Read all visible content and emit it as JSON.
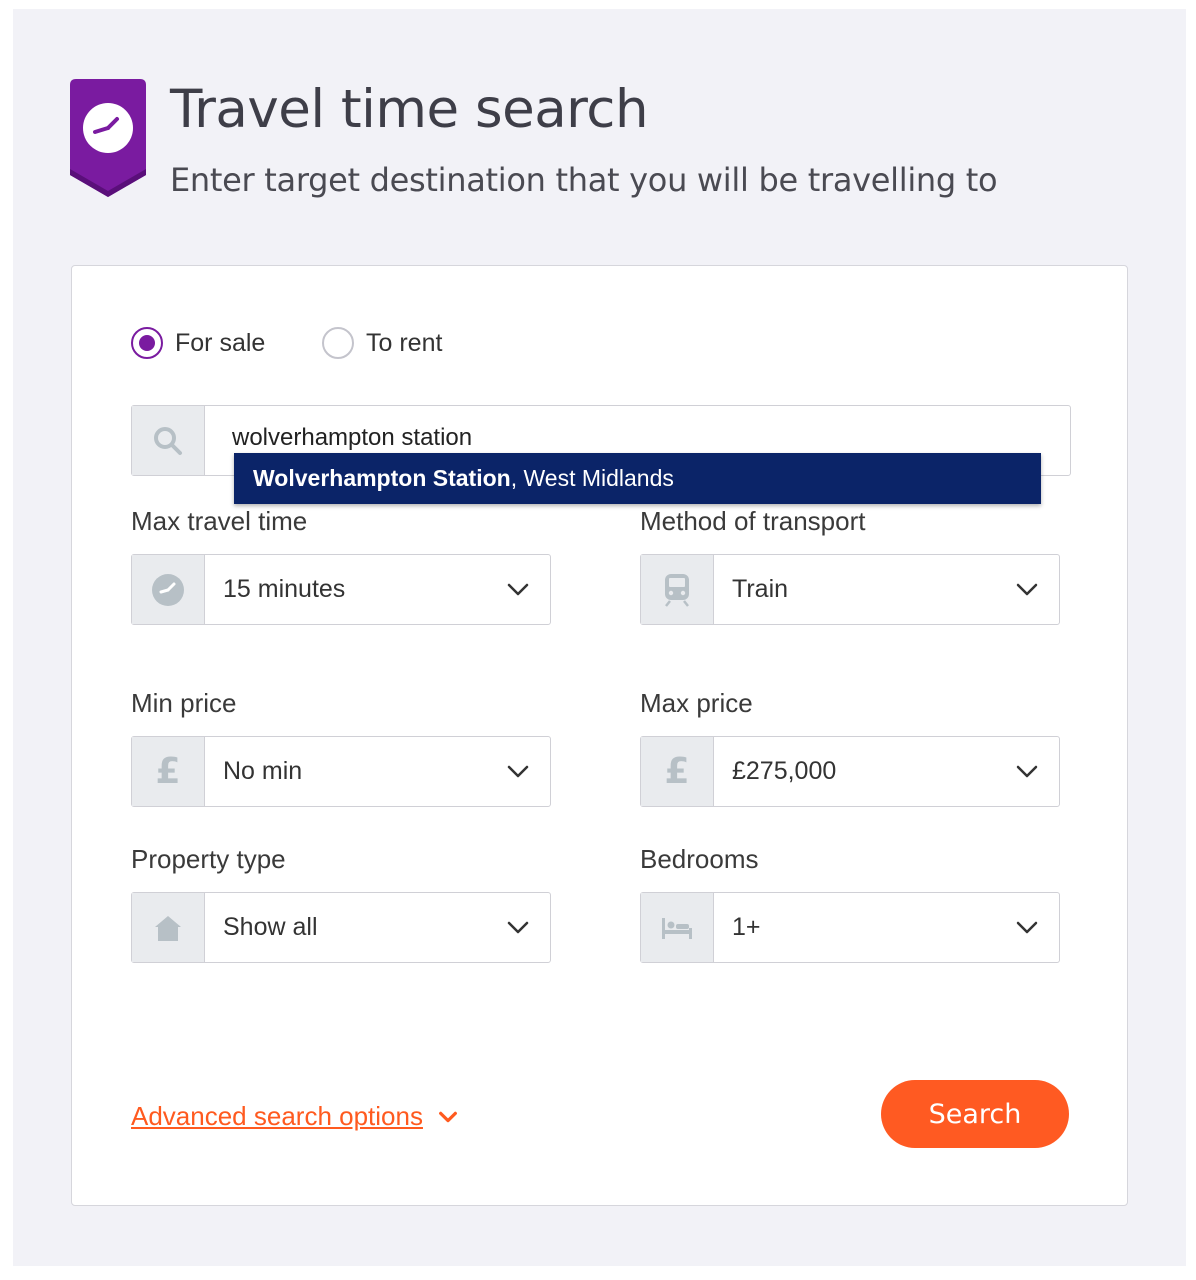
{
  "header": {
    "title": "Travel time search",
    "subtitle": "Enter target destination that you will be travelling to"
  },
  "listing_type": {
    "options": [
      "For sale",
      "To rent"
    ],
    "selected": "For sale"
  },
  "search": {
    "value": "wolverhampton station",
    "suggestion_bold": "Wolverhampton Station",
    "suggestion_rest": ", West Midlands"
  },
  "fields": {
    "max_travel_time": {
      "label": "Max travel time",
      "value": "15 minutes",
      "icon": "clock-icon"
    },
    "transport": {
      "label": "Method of transport",
      "value": "Train",
      "icon": "train-icon"
    },
    "min_price": {
      "label": "Min price",
      "value": "No min",
      "icon": "pound-icon",
      "icon_glyph": "£"
    },
    "max_price": {
      "label": "Max price",
      "value": "£275,000",
      "icon": "pound-icon",
      "icon_glyph": "£"
    },
    "property_type": {
      "label": "Property type",
      "value": "Show all",
      "icon": "house-icon"
    },
    "bedrooms": {
      "label": "Bedrooms",
      "value": "1+",
      "icon": "bed-icon"
    }
  },
  "footer": {
    "advanced_label": "Advanced search options",
    "search_label": "Search"
  },
  "colors": {
    "brand_purple": "#7a1ba0",
    "accent_orange": "#ff5a22",
    "suggestion_bg": "#0b2468",
    "icon_grey": "#b7c0c6"
  }
}
